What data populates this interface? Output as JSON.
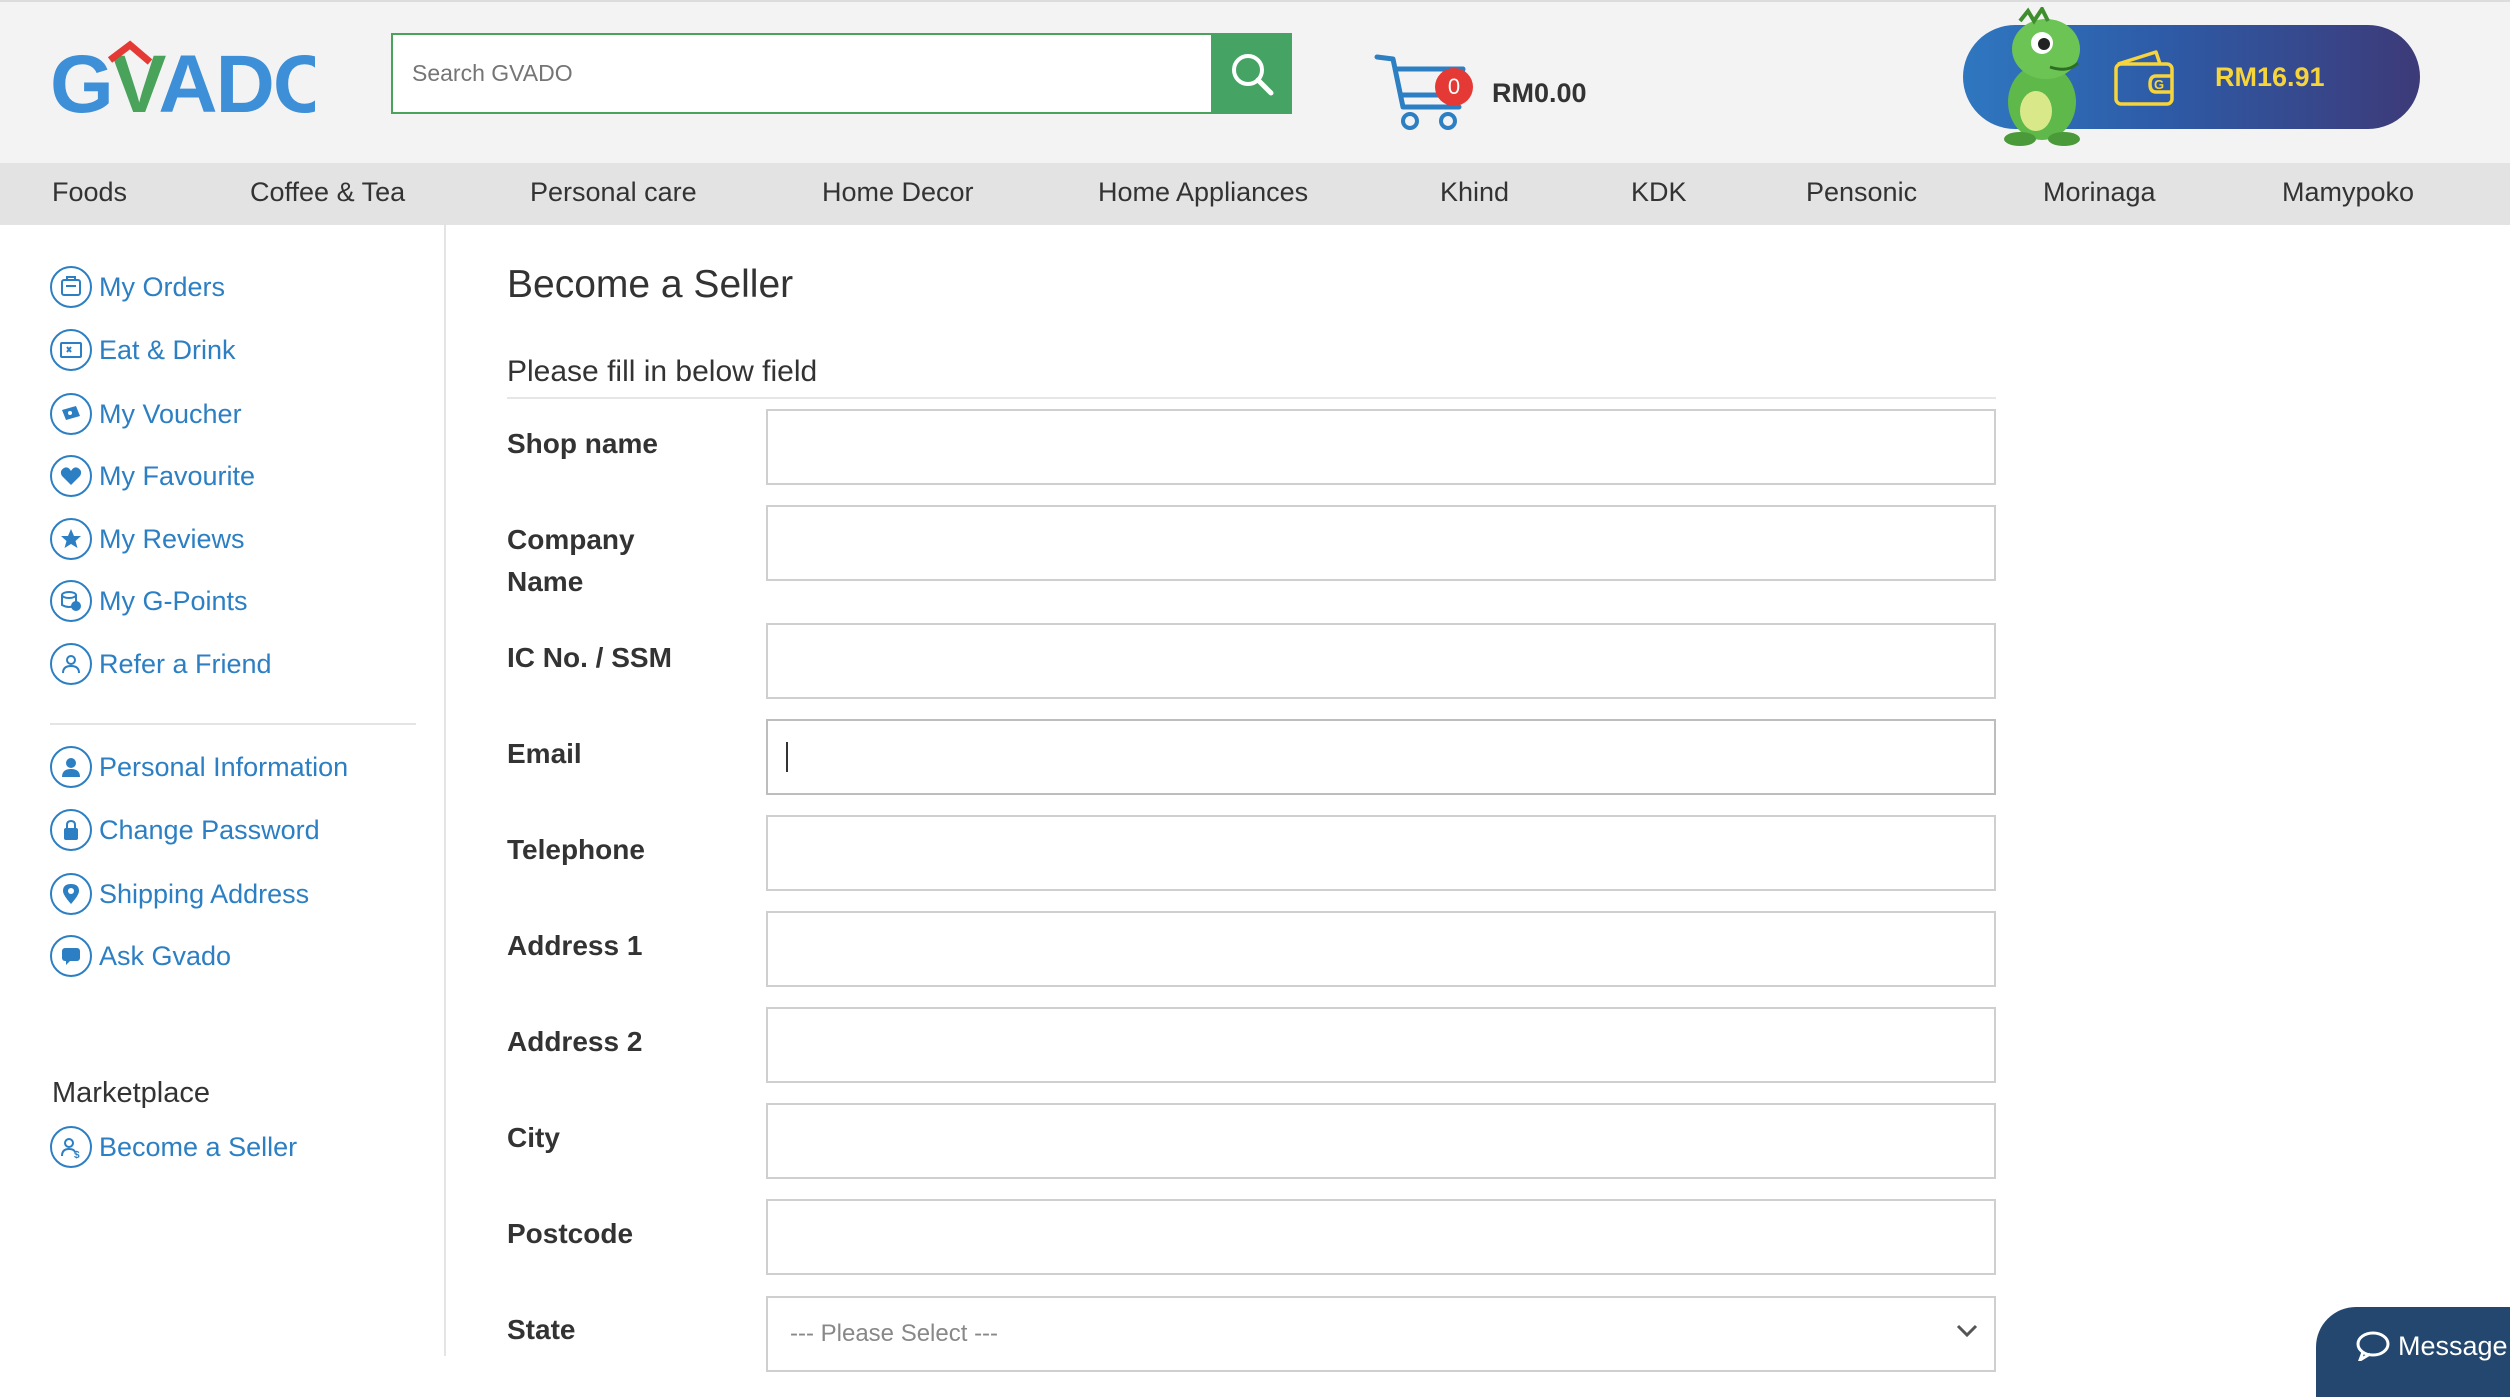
{
  "header": {
    "logo_text": "GVADO",
    "search": {
      "placeholder": "Search GVADO",
      "value": ""
    },
    "cart": {
      "count": "0",
      "total": "RM0.00"
    },
    "wallet": {
      "amount": "RM16.91"
    }
  },
  "categories": [
    "Foods",
    "Coffee & Tea",
    "Personal care",
    "Home Decor",
    "Home Appliances",
    "Khind",
    "KDK",
    "Pensonic",
    "Morinaga",
    "Mamypoko"
  ],
  "sidebar": {
    "account_items": [
      {
        "label": "My Orders",
        "icon": "orders-icon"
      },
      {
        "label": "Eat & Drink",
        "icon": "eat-drink-icon"
      },
      {
        "label": "My Voucher",
        "icon": "voucher-icon"
      },
      {
        "label": "My Favourite",
        "icon": "heart-icon"
      },
      {
        "label": "My Reviews",
        "icon": "star-icon"
      },
      {
        "label": "My G-Points",
        "icon": "coins-icon"
      },
      {
        "label": "Refer a Friend",
        "icon": "refer-icon"
      }
    ],
    "profile_items": [
      {
        "label": "Personal Information",
        "icon": "user-icon"
      },
      {
        "label": "Change Password",
        "icon": "lock-icon"
      },
      {
        "label": "Shipping Address",
        "icon": "location-pin-icon"
      },
      {
        "label": "Ask Gvado",
        "icon": "chat-icon"
      }
    ],
    "marketplace_heading": "Marketplace",
    "marketplace_items": [
      {
        "label": "Become a Seller",
        "icon": "seller-icon"
      }
    ]
  },
  "main": {
    "title": "Become a Seller",
    "section_label": "Please fill in below field",
    "fields": [
      {
        "label": "Shop name",
        "value": ""
      },
      {
        "label": "Company Name",
        "value": ""
      },
      {
        "label": "IC No. / SSM",
        "value": ""
      },
      {
        "label": "Email",
        "value": ""
      },
      {
        "label": "Telephone",
        "value": ""
      },
      {
        "label": "Address 1",
        "value": ""
      },
      {
        "label": "Address 2",
        "value": ""
      },
      {
        "label": "City",
        "value": ""
      },
      {
        "label": "Postcode",
        "value": ""
      },
      {
        "label": "State",
        "value": "--- Please Select ---"
      }
    ]
  },
  "message_button": {
    "label": "Message"
  },
  "colors": {
    "accent": "#2c7fc3",
    "search_green": "#45a463",
    "badge_red": "#e53935",
    "wallet_amount": "#f6d43c"
  }
}
